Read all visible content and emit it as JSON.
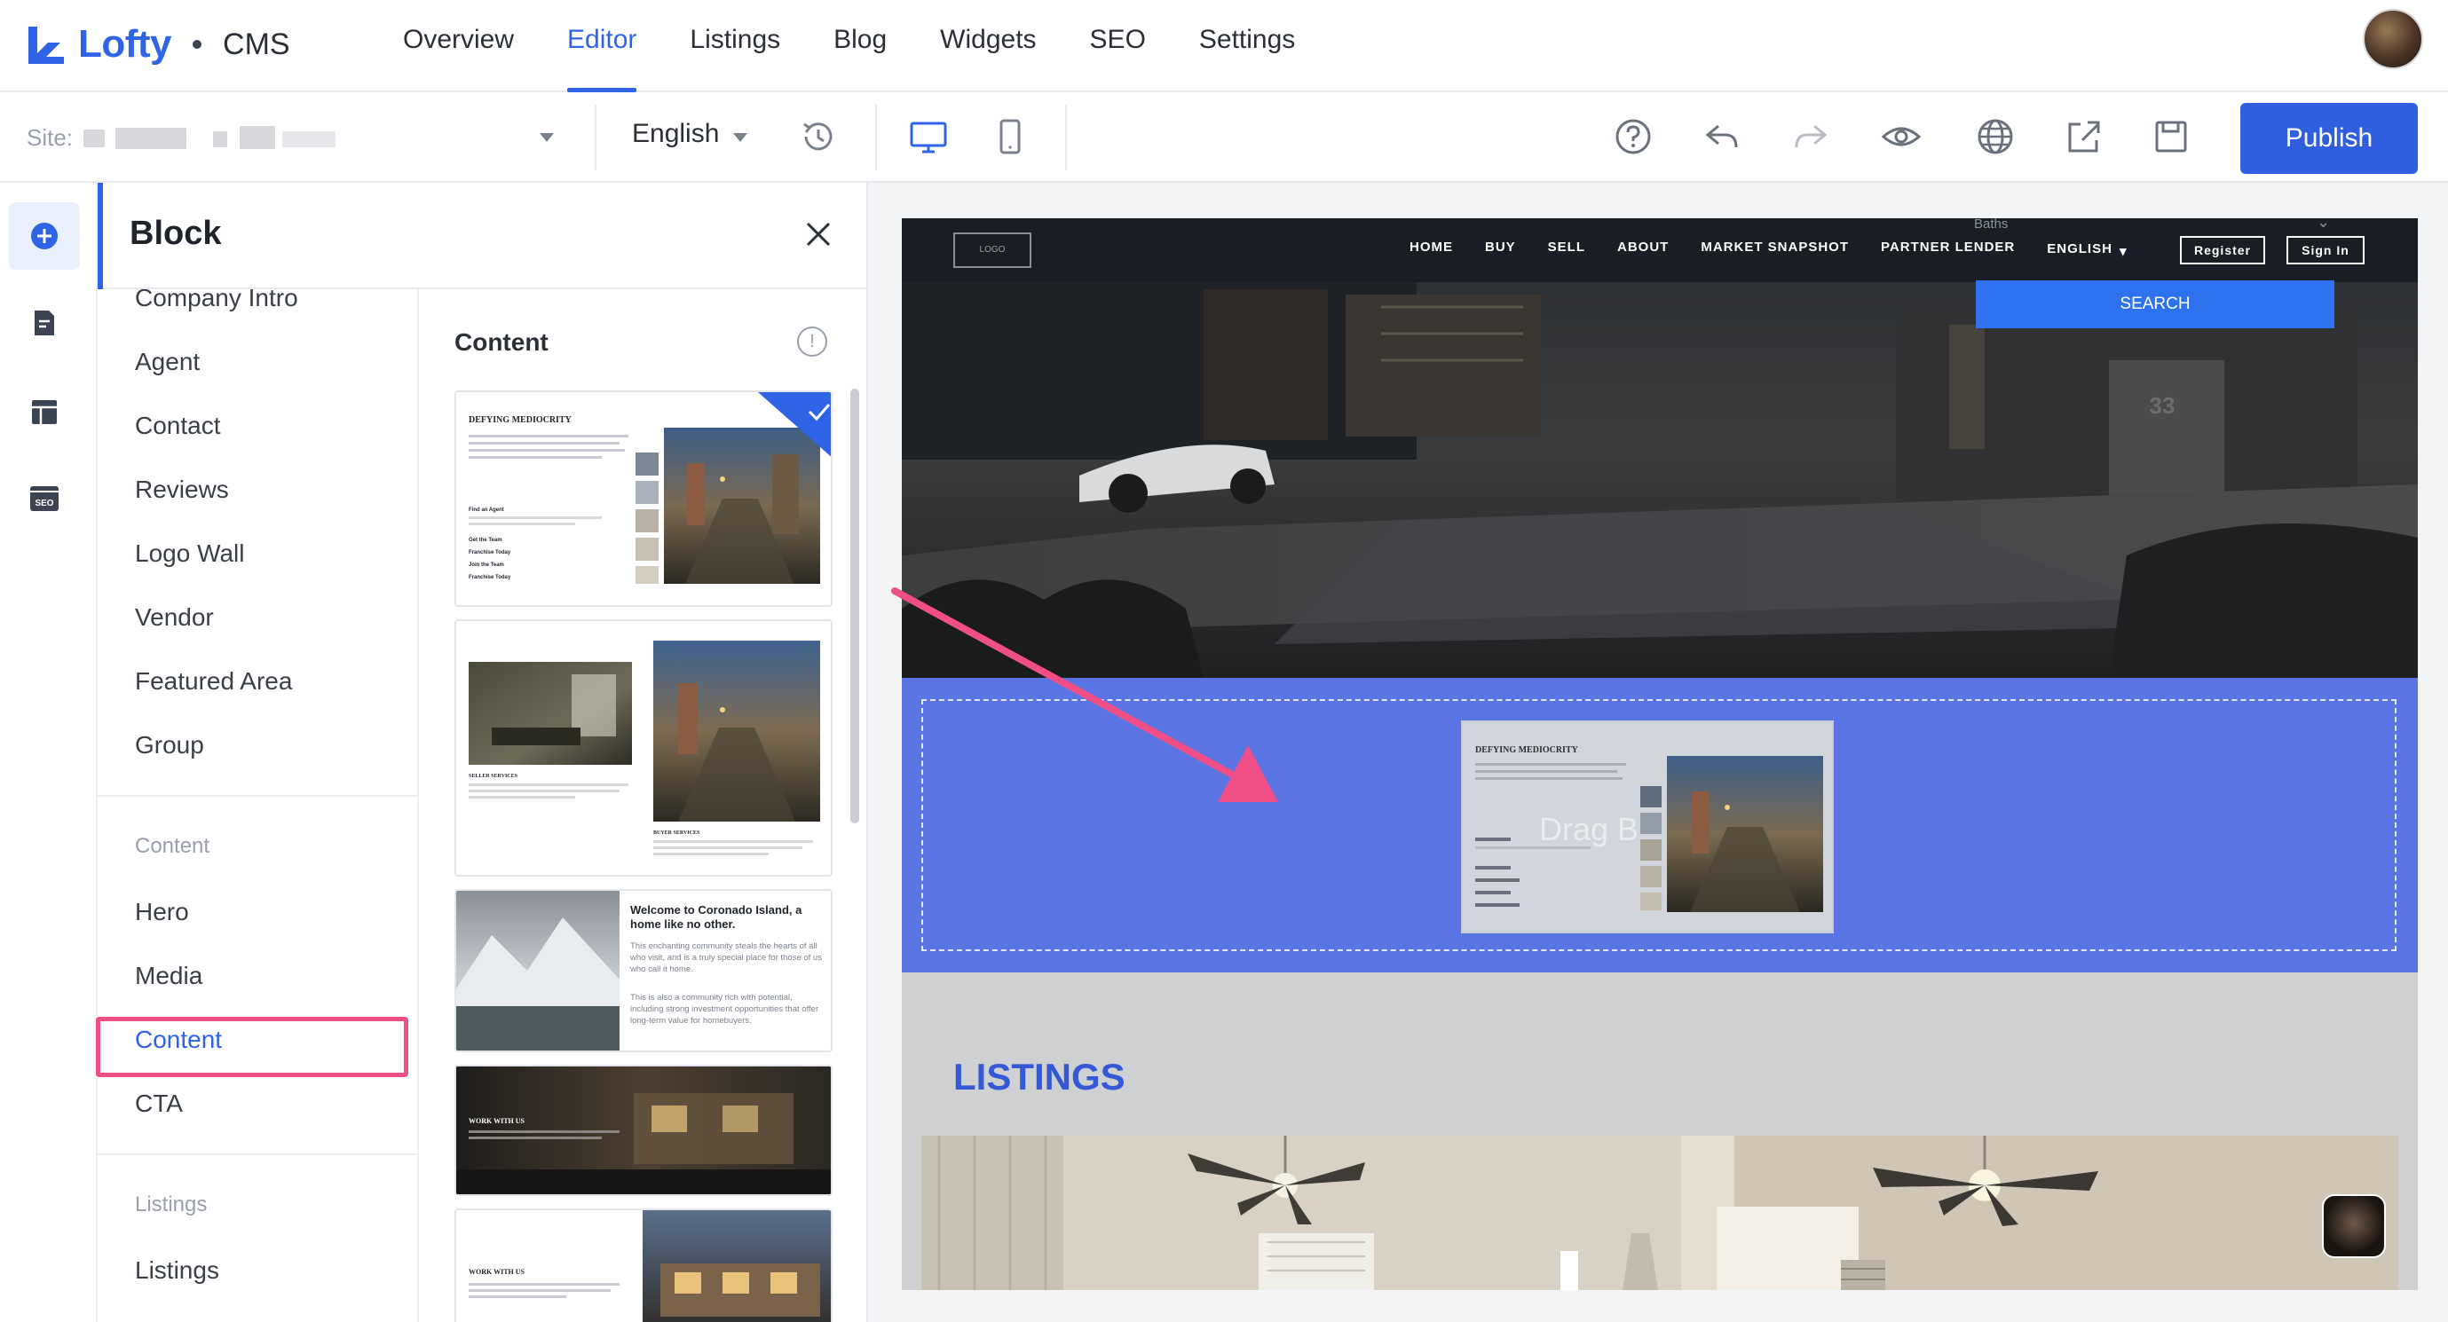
{
  "app": {
    "brand": "Lofty",
    "product": "CMS",
    "brand_color": "#2f64e6"
  },
  "nav": {
    "items": [
      {
        "label": "Overview",
        "active": false
      },
      {
        "label": "Editor",
        "active": true
      },
      {
        "label": "Listings",
        "active": false
      },
      {
        "label": "Blog",
        "active": false
      },
      {
        "label": "Widgets",
        "active": false
      },
      {
        "label": "SEO",
        "active": false
      },
      {
        "label": "Settings",
        "active": false
      }
    ]
  },
  "toolbar": {
    "site_label": "Site:",
    "language": "English",
    "publish_label": "Publish",
    "icons": [
      "history-icon",
      "desktop-icon",
      "mobile-icon",
      "help-icon",
      "undo-icon",
      "redo-icon",
      "preview-eye-icon",
      "globe-icon",
      "share-export-icon",
      "save-icon"
    ]
  },
  "rail": {
    "icons": [
      "add-block-icon",
      "page-icon",
      "layout-icon",
      "seo-icon"
    ],
    "seo_badge": "SEO"
  },
  "panel": {
    "title": "Block",
    "categories_top": [
      "Company Intro",
      "Agent",
      "Contact",
      "Reviews",
      "Logo Wall",
      "Vendor",
      "Featured Area",
      "Group"
    ],
    "section_content": "Content",
    "categories_content": [
      "Hero",
      "Media",
      "Content",
      "CTA"
    ],
    "selected_category": "Content",
    "section_listings": "Listings",
    "categories_listings": [
      "Listings"
    ],
    "thumbs_heading": "Content",
    "thumb1": {
      "title": "DEFYING MEDIOCRITY",
      "links": [
        "Find an Agent",
        "Get the Team",
        "Franchise Today",
        "Join the Team",
        "Franchise Today"
      ]
    },
    "thumb2": {
      "left_caption": "SELLER SERVICES",
      "right_caption": "BUYER SERVICES"
    },
    "thumb3": {
      "heading": "Welcome to Coronado Island, a home like no other.",
      "p1": "This enchanting community steals the hearts of all who visit, and is a truly special place for those of us who call it home.",
      "p2": "This is also a community rich with potential, including strong investment opportunities that offer long-term value for homebuyers."
    },
    "thumb4": {
      "heading": "WORK WITH US"
    },
    "thumb5": {
      "heading": "WORK WITH US"
    }
  },
  "preview": {
    "logo": "LOGO",
    "nav_links": [
      "HOME",
      "BUY",
      "SELL",
      "ABOUT",
      "MARKET SNAPSHOT",
      "PARTNER LENDER"
    ],
    "language": "ENGLISH",
    "register": "Register",
    "sign_in": "Sign In",
    "baths_label": "Baths",
    "search_label": "SEARCH",
    "house_number": "33",
    "drop_text": "Drag B",
    "drag_card_title": "DEFYING MEDIOCRITY",
    "listings_title": "LISTINGS",
    "drop_zone_color": "#5b74e3",
    "annotation_color": "#ef4f86"
  }
}
